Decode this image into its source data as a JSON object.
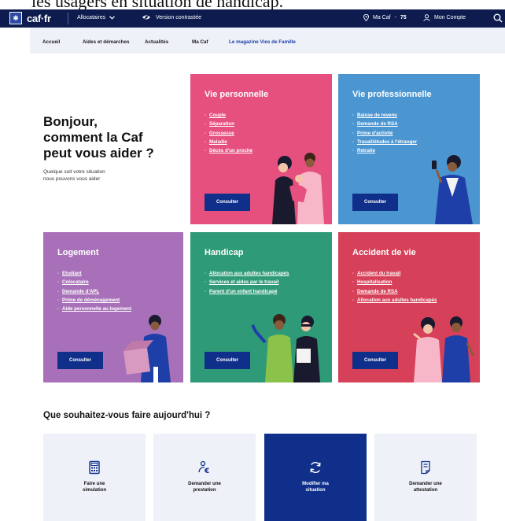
{
  "caption": "les usagers en situation de handicap.",
  "header": {
    "logo_text": "caf·fr",
    "allocataires": "Allocataires",
    "contrast": "Version contrastée",
    "ma_caf": "Ma Caf",
    "ma_caf_dept": "75",
    "mon_compte": "Mon Compte"
  },
  "nav": {
    "items": [
      "Accueil",
      "Aides et démarches",
      "Actualités",
      "Ma Caf",
      "Le magazine Vies de Famille"
    ]
  },
  "hero": {
    "title_line1": "Bonjour,",
    "title_line2": "comment la Caf",
    "title_line3": "peut vous aider ?",
    "subtitle_line1": "Quelque soit votre situation",
    "subtitle_line2": "nous pouvons vous aider"
  },
  "cards": {
    "vie_perso": {
      "title": "Vie personnelle",
      "links": [
        "Couple",
        "Séparation",
        "Grossesse",
        "Maladie",
        "Décès d'un proche"
      ],
      "button": "Consulter"
    },
    "vie_pro": {
      "title": "Vie professionnelle",
      "links": [
        "Baisse de revenu",
        "Demande de RSA",
        "Prime d'activité",
        "Travail/études à l'étranger",
        "Retraite"
      ],
      "button": "Consulter"
    },
    "logement": {
      "title": "Logement",
      "links": [
        "Etudiant",
        "Colocataire",
        "Demande d'APL",
        "Prime de déménagement",
        "Aide personnelle au logement"
      ],
      "button": "Consulter"
    },
    "handicap": {
      "title": "Handicap",
      "links": [
        "Allocation aux adultes handicapés",
        "Services et aides par le travail",
        "Parent d'un enfant handicapé"
      ],
      "button": "Consulter"
    },
    "accident": {
      "title": "Accident de vie",
      "links": [
        "Accident du travail",
        "Hospitalisation",
        "Demande de RSA",
        "Allocation aux adultes handicapés"
      ],
      "button": "Consulter"
    }
  },
  "actions": {
    "title": "Que souhaitez-vous faire aujourd'hui ?",
    "items": [
      {
        "line1": "Faire une",
        "line2": "simulation",
        "icon": "calculator-icon"
      },
      {
        "line1": "Demander une",
        "line2": "prestation",
        "icon": "money-request-icon"
      },
      {
        "line1": "Modifier ma",
        "line2": "situation",
        "icon": "refresh-icon"
      },
      {
        "line1": "Demander une",
        "line2": "attestation",
        "icon": "document-icon"
      }
    ]
  },
  "colors": {
    "topbar": "#0d1b4f",
    "primary_button": "#0f2f8a",
    "pink": "#e5507e",
    "blue": "#4b95d1",
    "purple": "#a870b8",
    "green": "#2e9a77",
    "red": "#d64058"
  }
}
